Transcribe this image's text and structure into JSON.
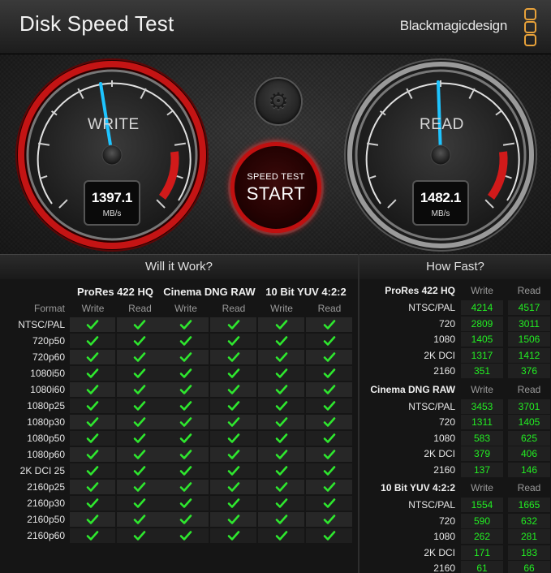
{
  "window": {
    "title": "Disk Speed Test",
    "brand": "Blackmagicdesign"
  },
  "gauges": {
    "write": {
      "label": "WRITE",
      "value": "1397.1",
      "unit": "MB/s"
    },
    "read": {
      "label": "READ",
      "value": "1482.1",
      "unit": "MB/s"
    }
  },
  "start_button": {
    "top": "SPEED TEST",
    "label": "START"
  },
  "settings_icon": "gear-icon",
  "sections": {
    "will_it_work": "Will it Work?",
    "how_fast": "How Fast?"
  },
  "will_it_work": {
    "format_header": "Format",
    "codecs": [
      "ProRes 422 HQ",
      "Cinema DNG RAW",
      "10 Bit YUV 4:2:2"
    ],
    "subcols": [
      "Write",
      "Read"
    ],
    "rows": [
      "NTSC/PAL",
      "720p50",
      "720p60",
      "1080i50",
      "1080i60",
      "1080p25",
      "1080p30",
      "1080p50",
      "1080p60",
      "2K DCI 25",
      "2160p25",
      "2160p30",
      "2160p50",
      "2160p60"
    ]
  },
  "how_fast": {
    "subcols": [
      "Write",
      "Read"
    ],
    "groups": [
      {
        "name": "ProRes 422 HQ",
        "rows": [
          {
            "fmt": "NTSC/PAL",
            "write": "4214",
            "read": "4517"
          },
          {
            "fmt": "720",
            "write": "2809",
            "read": "3011"
          },
          {
            "fmt": "1080",
            "write": "1405",
            "read": "1506"
          },
          {
            "fmt": "2K DCI",
            "write": "1317",
            "read": "1412"
          },
          {
            "fmt": "2160",
            "write": "351",
            "read": "376"
          }
        ]
      },
      {
        "name": "Cinema DNG RAW",
        "rows": [
          {
            "fmt": "NTSC/PAL",
            "write": "3453",
            "read": "3701"
          },
          {
            "fmt": "720",
            "write": "1311",
            "read": "1405"
          },
          {
            "fmt": "1080",
            "write": "583",
            "read": "625"
          },
          {
            "fmt": "2K DCI",
            "write": "379",
            "read": "406"
          },
          {
            "fmt": "2160",
            "write": "137",
            "read": "146"
          }
        ]
      },
      {
        "name": "10 Bit YUV 4:2:2",
        "rows": [
          {
            "fmt": "NTSC/PAL",
            "write": "1554",
            "read": "1665"
          },
          {
            "fmt": "720",
            "write": "590",
            "read": "632"
          },
          {
            "fmt": "1080",
            "write": "262",
            "read": "281"
          },
          {
            "fmt": "2K DCI",
            "write": "171",
            "read": "183"
          },
          {
            "fmt": "2160",
            "write": "61",
            "read": "66"
          }
        ]
      }
    ]
  },
  "colors": {
    "check": "#2ee82e",
    "value": "#22ee22",
    "accent_red": "#d11a1a",
    "needle": "#1ec4ff"
  }
}
